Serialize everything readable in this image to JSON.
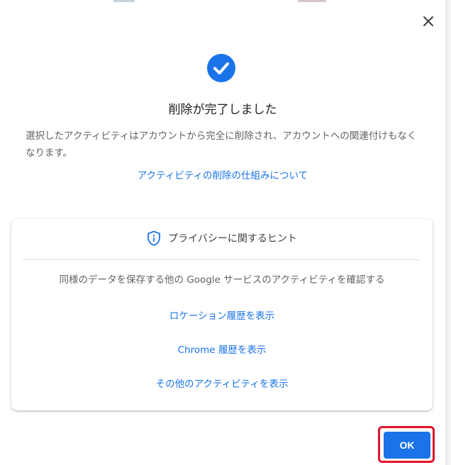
{
  "dialog": {
    "close_label": "×",
    "title": "削除が完了しました",
    "description": "選択したアクティビティはアカウントから完全に削除され、アカウントへの関連付けもなくなります。",
    "about_link": "アクティビティの削除の仕組みについて",
    "ok_label": "OK"
  },
  "privacy_tips": {
    "header": "プライバシーに関するヒント",
    "description": "同様のデータを保存する他の Google サービスのアクティビティを確認する",
    "links": [
      "ロケーション履歴を表示",
      "Chrome 履歴を表示",
      "その他のアクティビティを表示"
    ]
  },
  "colors": {
    "accent": "#1a73e8",
    "highlight": "#e0142b"
  },
  "icons": {
    "close": "close-icon",
    "success": "check-circle-icon",
    "privacy": "shield-icon"
  }
}
